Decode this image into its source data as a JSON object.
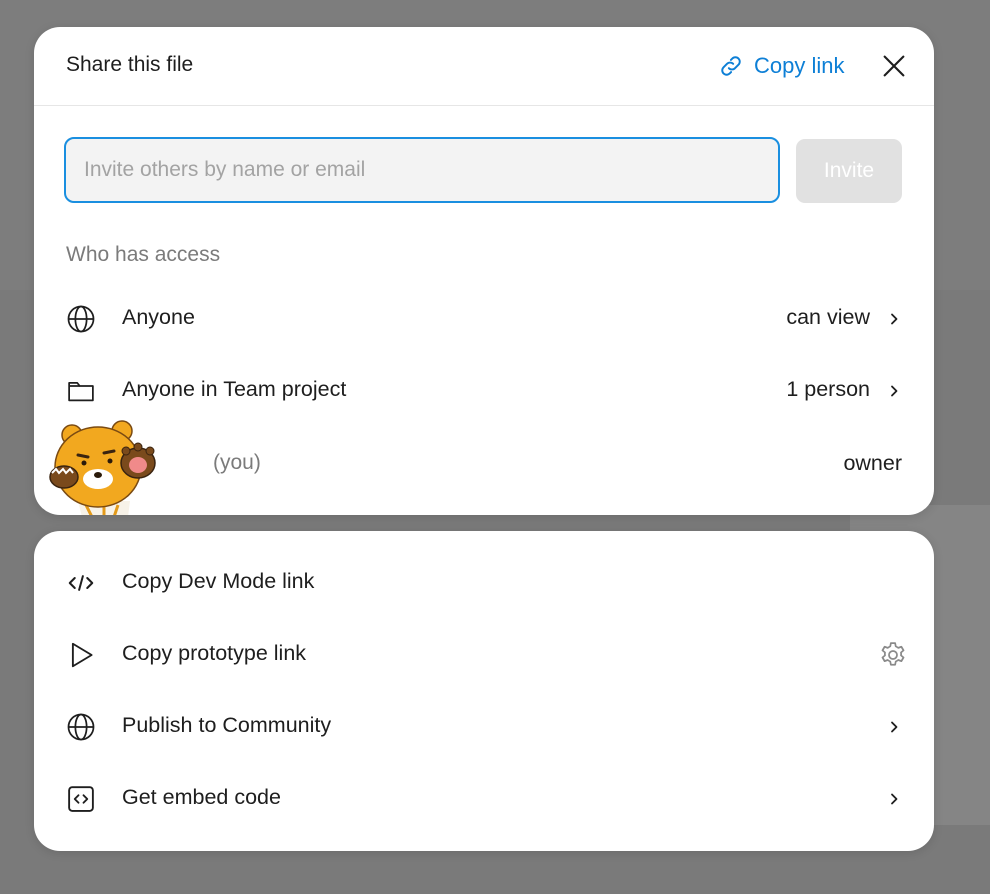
{
  "share_dialog": {
    "title": "Share this file",
    "copy_link_label": "Copy link",
    "invite": {
      "placeholder": "Invite others by name or email",
      "button_label": "Invite"
    },
    "section_label": "Who has access",
    "access": [
      {
        "icon": "globe-icon",
        "label": "Anyone",
        "value": "can view"
      },
      {
        "icon": "folder-icon",
        "label": "Anyone in Team project",
        "value": "1 person"
      }
    ],
    "owner_row": {
      "you_label": "(you)",
      "role": "owner"
    }
  },
  "links_panel": {
    "items": [
      {
        "icon": "code-icon",
        "label": "Copy Dev Mode link"
      },
      {
        "icon": "play-icon",
        "label": "Copy prototype link",
        "action_icon": "gear-icon"
      },
      {
        "icon": "globe-icon",
        "label": "Publish to Community",
        "action_icon": "chevron-right-icon"
      },
      {
        "icon": "embed-code-icon",
        "label": "Get embed code",
        "action_icon": "chevron-right-icon"
      }
    ]
  },
  "colors": {
    "accent": "#0d7fd6",
    "input_border": "#1a8fe0",
    "invite_button_disabled": "#e1e1e1",
    "backdrop": "#7a7a7a"
  }
}
